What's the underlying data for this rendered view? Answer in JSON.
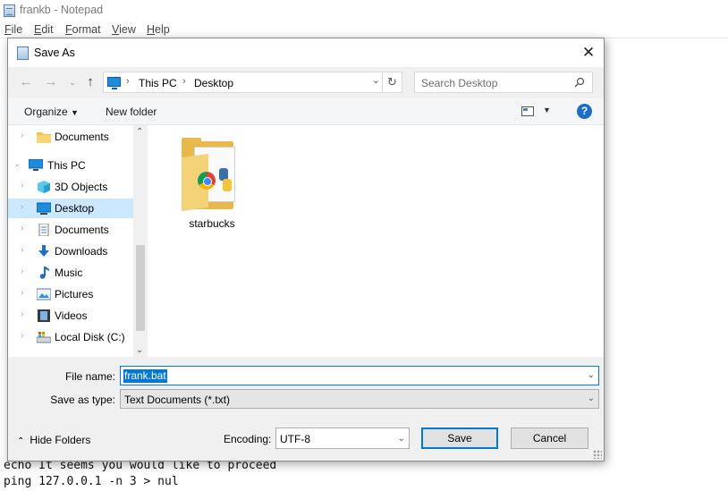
{
  "notepad": {
    "title": "frankb - Notepad",
    "menu": [
      "File",
      "Edit",
      "Format",
      "View",
      "Help"
    ],
    "bottom_lines": [
      "echo It seems you would like to proceed",
      "ping 127.0.0.1 -n 3 > nul"
    ]
  },
  "dialog": {
    "title": "Save As",
    "address": {
      "segments": [
        "This PC",
        "Desktop"
      ]
    },
    "search": {
      "placeholder": "Search Desktop"
    },
    "commands": {
      "organize": "Organize",
      "new_folder": "New folder"
    },
    "nav": {
      "items": [
        {
          "label": "Documents",
          "icon": "folder-icon",
          "level": 1,
          "expanded": false,
          "selected": false
        },
        {
          "label": "This PC",
          "icon": "computer-icon",
          "level": 0,
          "expanded": true,
          "selected": false
        },
        {
          "label": "3D Objects",
          "icon": "cube-icon",
          "level": 1,
          "expanded": false,
          "selected": false
        },
        {
          "label": "Desktop",
          "icon": "desktop-icon",
          "level": 1,
          "expanded": false,
          "selected": true
        },
        {
          "label": "Documents",
          "icon": "document-icon",
          "level": 1,
          "expanded": false,
          "selected": false
        },
        {
          "label": "Downloads",
          "icon": "download-icon",
          "level": 1,
          "expanded": false,
          "selected": false
        },
        {
          "label": "Music",
          "icon": "music-icon",
          "level": 1,
          "expanded": false,
          "selected": false
        },
        {
          "label": "Pictures",
          "icon": "pictures-icon",
          "level": 1,
          "expanded": false,
          "selected": false
        },
        {
          "label": "Videos",
          "icon": "videos-icon",
          "level": 1,
          "expanded": false,
          "selected": false
        },
        {
          "label": "Local Disk (C:)",
          "icon": "disk-icon",
          "level": 1,
          "expanded": false,
          "selected": false
        }
      ]
    },
    "files": [
      {
        "name": "starbucks",
        "type": "folder"
      }
    ],
    "file_name": {
      "label": "File name:",
      "value": "frank.bat"
    },
    "save_as_type": {
      "label": "Save as type:",
      "value": "Text Documents (*.txt)"
    },
    "hide_folders": "Hide Folders",
    "encoding": {
      "label": "Encoding:",
      "value": "UTF-8"
    },
    "buttons": {
      "save": "Save",
      "cancel": "Cancel"
    },
    "colors": {
      "accent": "#0078d7",
      "selection": "#cce8ff",
      "dialog_bg": "#f0f0f0"
    }
  }
}
